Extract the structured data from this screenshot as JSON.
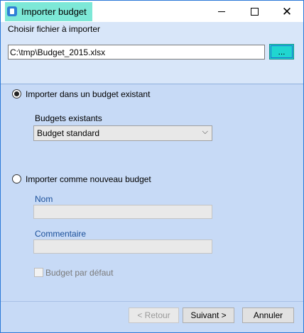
{
  "window": {
    "title": "Importer budget",
    "controls": {
      "minimize": "minimize",
      "maximize": "maximize",
      "close": "close"
    }
  },
  "file": {
    "label": "Choisir fichier à importer",
    "path": "C:\\tmp\\Budget_2015.xlsx",
    "browse_label": "..."
  },
  "existing": {
    "radio_label": "Importer dans un budget existant",
    "selected": true,
    "budgets_label": "Budgets existants",
    "budget_value": "Budget standard"
  },
  "new_budget": {
    "radio_label": "Importer comme nouveau budget",
    "selected": false,
    "name_label": "Nom",
    "name_value": "",
    "comment_label": "Commentaire",
    "comment_value": "",
    "default_label": "Budget par défaut",
    "default_checked": false
  },
  "buttons": {
    "back": "< Retour",
    "next": "Suivant >",
    "cancel": "Annuler"
  },
  "colors": {
    "title_highlight": "#7de8d7",
    "browse_button": "#20d6d0",
    "dialog_bg": "#c7daf6",
    "label_blue": "#1a4f99"
  }
}
